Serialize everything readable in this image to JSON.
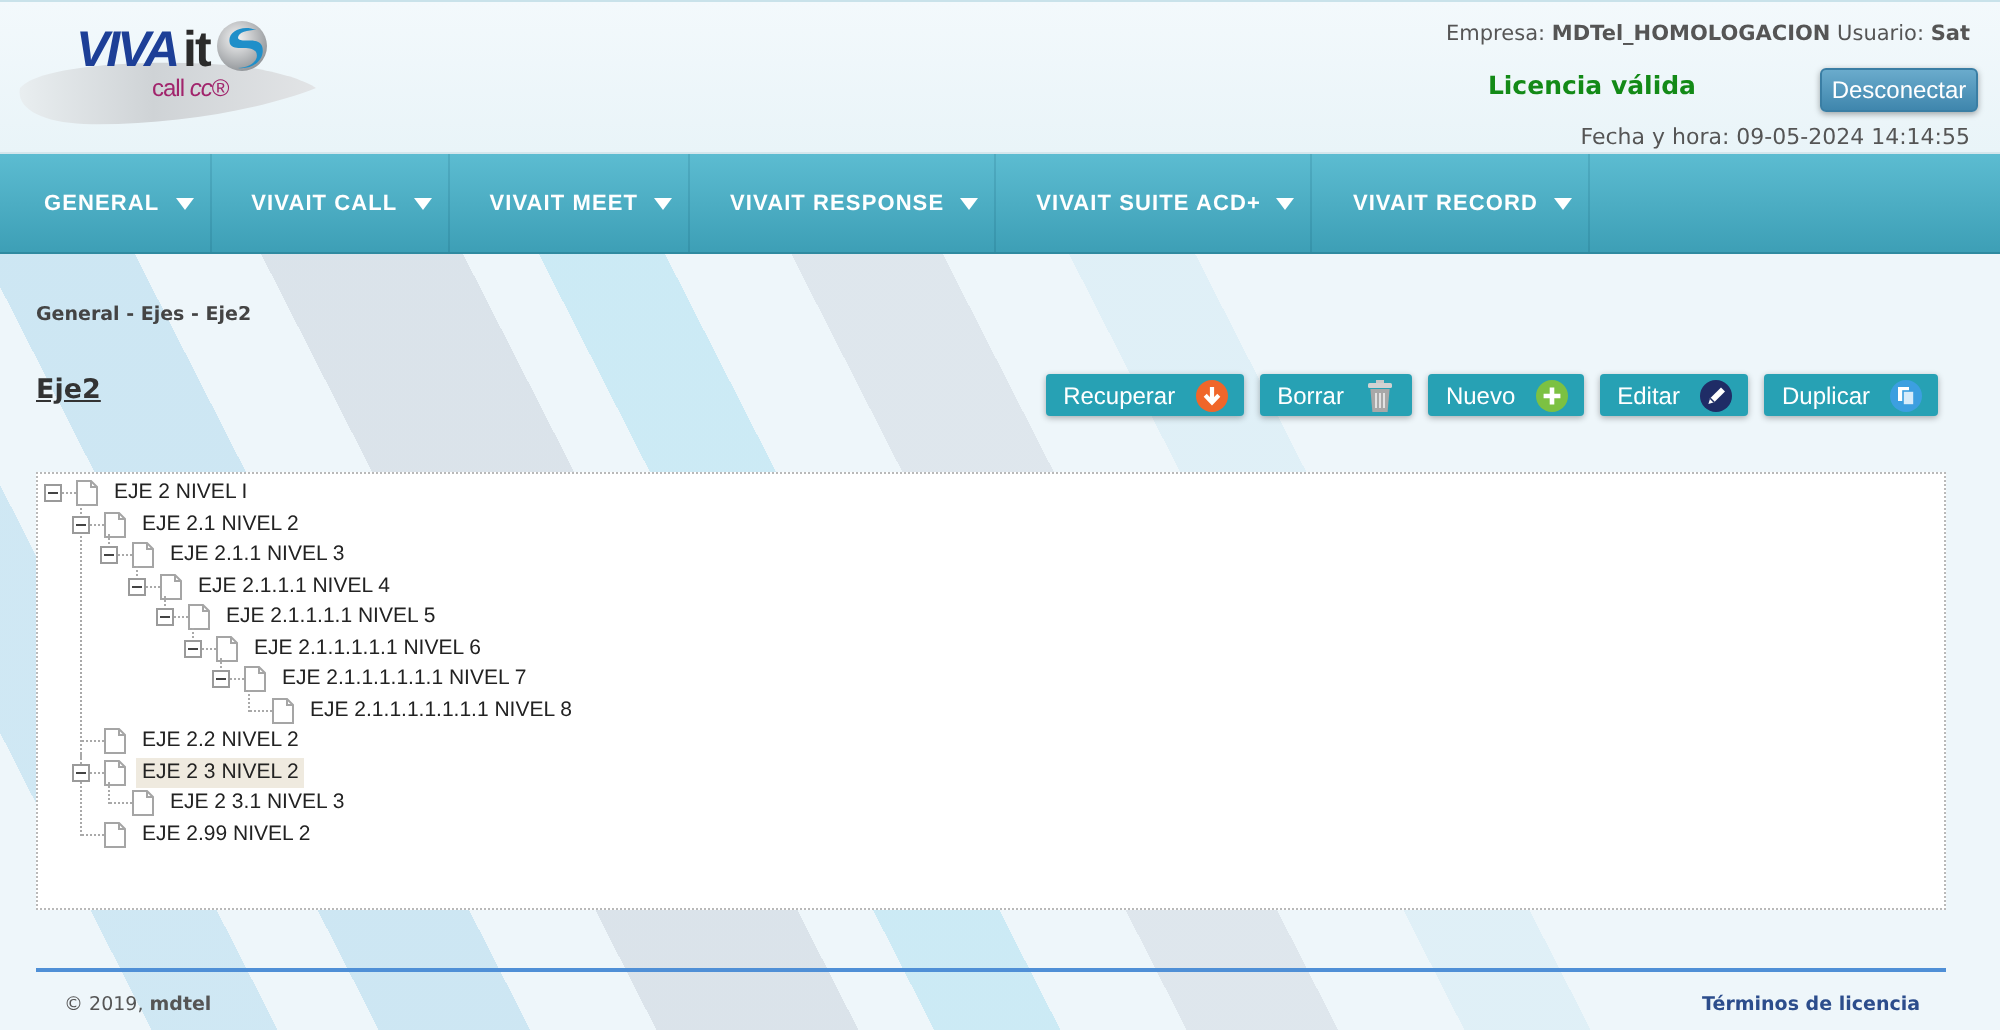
{
  "header": {
    "logo": {
      "wordmark_main": "VIVA",
      "wordmark_suffix": "it",
      "tagline": "call *cc*®"
    },
    "account_line": "Empresa: **MDTel_HOMOLOGACION** Usuario: **Sat**",
    "license_status": "Licencia válida",
    "disconnect_button": "Desconectar",
    "datetime": "Fecha y hora: 09-05-2024 14:14:55"
  },
  "nav": {
    "items": [
      {
        "label": "GENERAL"
      },
      {
        "label": "VIVAIT CALL"
      },
      {
        "label": "VIVAIT MEET"
      },
      {
        "label": "VIVAIT RESPONSE"
      },
      {
        "label": "VIVAIT SUITE ACD+"
      },
      {
        "label": "VIVAIT RECORD"
      }
    ]
  },
  "breadcrumb": "General - Ejes - Eje2",
  "page_title": "Eje2",
  "actions": [
    {
      "label": "Recuperar",
      "kind": "recover"
    },
    {
      "label": "Borrar",
      "kind": "delete"
    },
    {
      "label": "Nuevo",
      "kind": "add"
    },
    {
      "label": "Editar",
      "kind": "edit"
    },
    {
      "label": "Duplicar",
      "kind": "duplicate"
    }
  ],
  "tree": {
    "items": [
      {
        "label": "EJE 2 NIVEL I",
        "selected": false,
        "expanded": true,
        "children": [
          {
            "label": "EJE 2.1 NIVEL 2",
            "selected": false,
            "expanded": true,
            "children": [
              {
                "label": "EJE 2.1.1 NIVEL 3",
                "selected": false,
                "expanded": true,
                "children": [
                  {
                    "label": "EJE 2.1.1.1 NIVEL 4",
                    "selected": false,
                    "expanded": true,
                    "children": [
                      {
                        "label": "EJE 2.1.1.1.1 NIVEL 5",
                        "selected": false,
                        "expanded": true,
                        "children": [
                          {
                            "label": "EJE 2.1.1.1.1.1 NIVEL 6",
                            "selected": false,
                            "expanded": true,
                            "children": [
                              {
                                "label": "EJE 2.1.1.1.1.1.1 NIVEL 7",
                                "selected": false,
                                "expanded": true,
                                "children": [
                                  {
                                    "label": "EJE 2.1.1.1.1.1.1.1 NIVEL 8",
                                    "selected": false
                                  }
                                ]
                              }
                            ]
                          }
                        ]
                      }
                    ]
                  }
                ]
              }
            ]
          },
          {
            "label": "EJE 2.2 NIVEL 2",
            "selected": false
          },
          {
            "label": "EJE 2 3 NIVEL 2",
            "selected": true,
            "expanded": true,
            "children": [
              {
                "label": "EJE 2 3.1 NIVEL 3",
                "selected": false
              }
            ]
          },
          {
            "label": "EJE 2.99 NIVEL 2",
            "selected": false
          }
        ]
      }
    ]
  },
  "footer": {
    "copyright": "© 2019, **mdtel**",
    "license_link": "Términos de licencia"
  }
}
